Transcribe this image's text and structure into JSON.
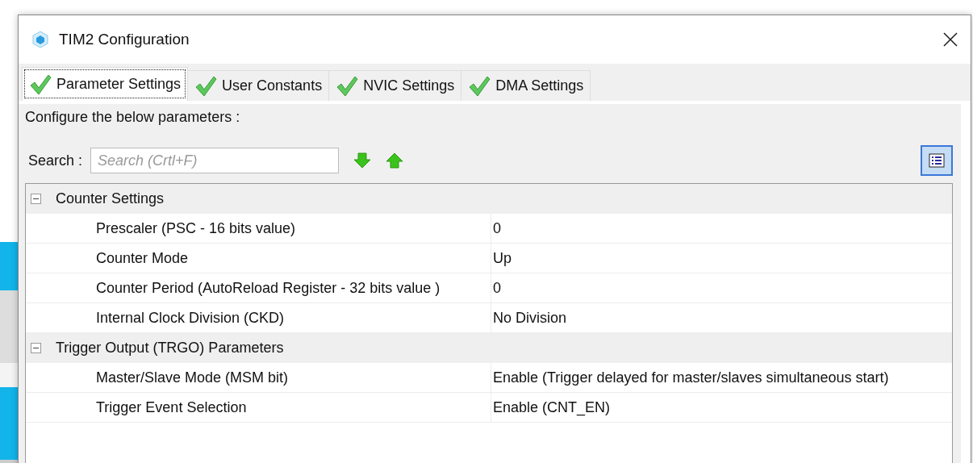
{
  "window": {
    "title": "TIM2 Configuration"
  },
  "tabs": [
    {
      "label": "Parameter Settings",
      "selected": true
    },
    {
      "label": "User Constants",
      "selected": false
    },
    {
      "label": "NVIC Settings",
      "selected": false
    },
    {
      "label": "DMA Settings",
      "selected": false
    }
  ],
  "instruction": "Configure the below parameters :",
  "search": {
    "label": "Search :",
    "placeholder": "Search (Crtl+F)"
  },
  "list_view_toggle": {
    "selected": true
  },
  "groups": [
    {
      "name": "Counter Settings",
      "expanded": true,
      "children": [
        {
          "name": "Prescaler (PSC - 16 bits value)",
          "value": "0"
        },
        {
          "name": "Counter Mode",
          "value": "Up"
        },
        {
          "name": "Counter Period (AutoReload Register - 32 bits value )",
          "value": "0"
        },
        {
          "name": "Internal Clock Division (CKD)",
          "value": "No Division"
        }
      ]
    },
    {
      "name": "Trigger Output (TRGO) Parameters",
      "expanded": true,
      "children": [
        {
          "name": "Master/Slave Mode (MSM bit)",
          "value": "Enable (Trigger delayed for master/slaves simultaneous start)"
        },
        {
          "name": "Trigger Event Selection",
          "value": "Enable (CNT_EN)"
        }
      ]
    }
  ]
}
